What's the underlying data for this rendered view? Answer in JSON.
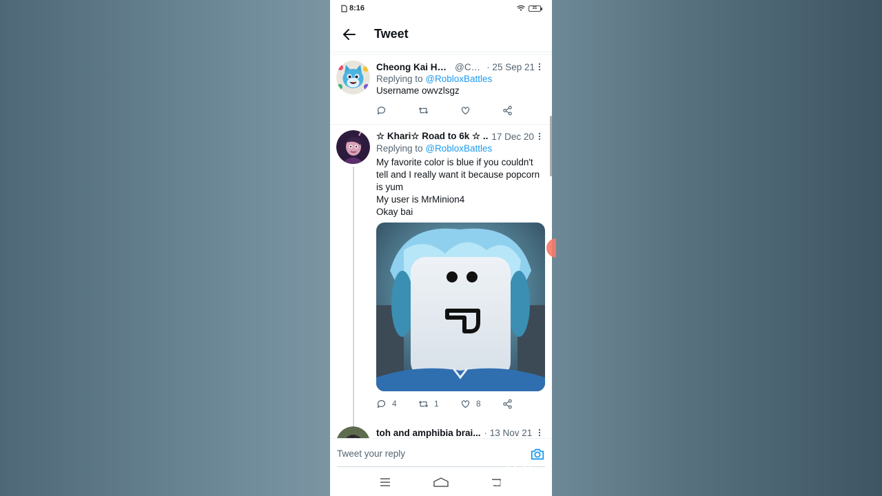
{
  "status": {
    "time": "8:16",
    "battery": "31"
  },
  "topbar": {
    "title": "Tweet"
  },
  "tweets": [
    {
      "name": "Cheong Kai Hong",
      "handle": "@Ch...",
      "date": "· 25 Sep 21",
      "replying_label": "Replying to",
      "replying_to": "@RobloxBattles",
      "text": "Username owvzlsgz",
      "counts": {
        "reply": "",
        "retweet": "",
        "like": ""
      }
    },
    {
      "name": "☆ Khari☆ Road to 6k ☆ ..",
      "handle": "",
      "date": "17 Dec 20",
      "replying_label": "Replying to",
      "replying_to": "@RobloxBattles",
      "lines": [
        "My favorite color is blue if you couldn't tell and I really want it because popcorn is yum",
        "My user is MrMinion4",
        "Okay bai"
      ],
      "counts": {
        "reply": "4",
        "retweet": "1",
        "like": "8"
      }
    },
    {
      "name": "toh and amphibia brai...",
      "handle": "",
      "date": "· 13 Nov 21"
    }
  ],
  "reply_bar": {
    "placeholder": "Tweet your reply"
  },
  "watermark": {
    "text": "RECORDER"
  },
  "icons": {
    "back": "back-arrow-icon",
    "more": "more-vertical-icon",
    "reply": "reply-icon",
    "retweet": "retweet-icon",
    "like": "heart-icon",
    "share": "share-icon",
    "camera": "camera-icon"
  },
  "colors": {
    "accent": "#1d9bf0",
    "secondary_text": "#536471"
  }
}
